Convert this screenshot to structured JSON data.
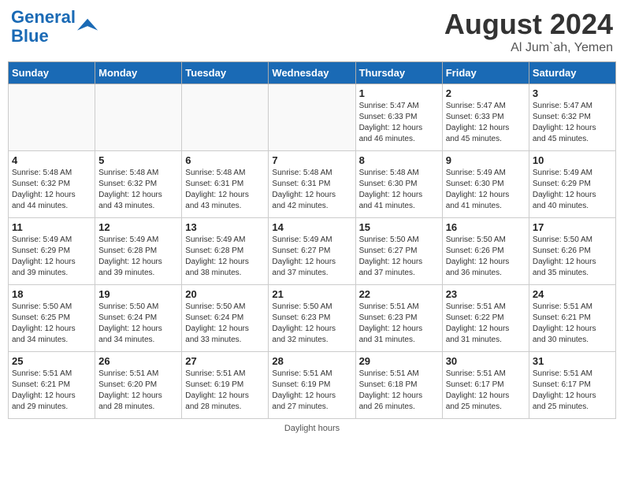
{
  "header": {
    "logo_line1": "General",
    "logo_line2": "Blue",
    "month": "August 2024",
    "location": "Al Jum`ah, Yemen"
  },
  "days_of_week": [
    "Sunday",
    "Monday",
    "Tuesday",
    "Wednesday",
    "Thursday",
    "Friday",
    "Saturday"
  ],
  "footer": {
    "daylight_label": "Daylight hours"
  },
  "weeks": [
    [
      {
        "day": "",
        "info": ""
      },
      {
        "day": "",
        "info": ""
      },
      {
        "day": "",
        "info": ""
      },
      {
        "day": "",
        "info": ""
      },
      {
        "day": "1",
        "info": "Sunrise: 5:47 AM\nSunset: 6:33 PM\nDaylight: 12 hours\nand 46 minutes."
      },
      {
        "day": "2",
        "info": "Sunrise: 5:47 AM\nSunset: 6:33 PM\nDaylight: 12 hours\nand 45 minutes."
      },
      {
        "day": "3",
        "info": "Sunrise: 5:47 AM\nSunset: 6:32 PM\nDaylight: 12 hours\nand 45 minutes."
      }
    ],
    [
      {
        "day": "4",
        "info": "Sunrise: 5:48 AM\nSunset: 6:32 PM\nDaylight: 12 hours\nand 44 minutes."
      },
      {
        "day": "5",
        "info": "Sunrise: 5:48 AM\nSunset: 6:32 PM\nDaylight: 12 hours\nand 43 minutes."
      },
      {
        "day": "6",
        "info": "Sunrise: 5:48 AM\nSunset: 6:31 PM\nDaylight: 12 hours\nand 43 minutes."
      },
      {
        "day": "7",
        "info": "Sunrise: 5:48 AM\nSunset: 6:31 PM\nDaylight: 12 hours\nand 42 minutes."
      },
      {
        "day": "8",
        "info": "Sunrise: 5:48 AM\nSunset: 6:30 PM\nDaylight: 12 hours\nand 41 minutes."
      },
      {
        "day": "9",
        "info": "Sunrise: 5:49 AM\nSunset: 6:30 PM\nDaylight: 12 hours\nand 41 minutes."
      },
      {
        "day": "10",
        "info": "Sunrise: 5:49 AM\nSunset: 6:29 PM\nDaylight: 12 hours\nand 40 minutes."
      }
    ],
    [
      {
        "day": "11",
        "info": "Sunrise: 5:49 AM\nSunset: 6:29 PM\nDaylight: 12 hours\nand 39 minutes."
      },
      {
        "day": "12",
        "info": "Sunrise: 5:49 AM\nSunset: 6:28 PM\nDaylight: 12 hours\nand 39 minutes."
      },
      {
        "day": "13",
        "info": "Sunrise: 5:49 AM\nSunset: 6:28 PM\nDaylight: 12 hours\nand 38 minutes."
      },
      {
        "day": "14",
        "info": "Sunrise: 5:49 AM\nSunset: 6:27 PM\nDaylight: 12 hours\nand 37 minutes."
      },
      {
        "day": "15",
        "info": "Sunrise: 5:50 AM\nSunset: 6:27 PM\nDaylight: 12 hours\nand 37 minutes."
      },
      {
        "day": "16",
        "info": "Sunrise: 5:50 AM\nSunset: 6:26 PM\nDaylight: 12 hours\nand 36 minutes."
      },
      {
        "day": "17",
        "info": "Sunrise: 5:50 AM\nSunset: 6:26 PM\nDaylight: 12 hours\nand 35 minutes."
      }
    ],
    [
      {
        "day": "18",
        "info": "Sunrise: 5:50 AM\nSunset: 6:25 PM\nDaylight: 12 hours\nand 34 minutes."
      },
      {
        "day": "19",
        "info": "Sunrise: 5:50 AM\nSunset: 6:24 PM\nDaylight: 12 hours\nand 34 minutes."
      },
      {
        "day": "20",
        "info": "Sunrise: 5:50 AM\nSunset: 6:24 PM\nDaylight: 12 hours\nand 33 minutes."
      },
      {
        "day": "21",
        "info": "Sunrise: 5:50 AM\nSunset: 6:23 PM\nDaylight: 12 hours\nand 32 minutes."
      },
      {
        "day": "22",
        "info": "Sunrise: 5:51 AM\nSunset: 6:23 PM\nDaylight: 12 hours\nand 31 minutes."
      },
      {
        "day": "23",
        "info": "Sunrise: 5:51 AM\nSunset: 6:22 PM\nDaylight: 12 hours\nand 31 minutes."
      },
      {
        "day": "24",
        "info": "Sunrise: 5:51 AM\nSunset: 6:21 PM\nDaylight: 12 hours\nand 30 minutes."
      }
    ],
    [
      {
        "day": "25",
        "info": "Sunrise: 5:51 AM\nSunset: 6:21 PM\nDaylight: 12 hours\nand 29 minutes."
      },
      {
        "day": "26",
        "info": "Sunrise: 5:51 AM\nSunset: 6:20 PM\nDaylight: 12 hours\nand 28 minutes."
      },
      {
        "day": "27",
        "info": "Sunrise: 5:51 AM\nSunset: 6:19 PM\nDaylight: 12 hours\nand 28 minutes."
      },
      {
        "day": "28",
        "info": "Sunrise: 5:51 AM\nSunset: 6:19 PM\nDaylight: 12 hours\nand 27 minutes."
      },
      {
        "day": "29",
        "info": "Sunrise: 5:51 AM\nSunset: 6:18 PM\nDaylight: 12 hours\nand 26 minutes."
      },
      {
        "day": "30",
        "info": "Sunrise: 5:51 AM\nSunset: 6:17 PM\nDaylight: 12 hours\nand 25 minutes."
      },
      {
        "day": "31",
        "info": "Sunrise: 5:51 AM\nSunset: 6:17 PM\nDaylight: 12 hours\nand 25 minutes."
      }
    ]
  ]
}
